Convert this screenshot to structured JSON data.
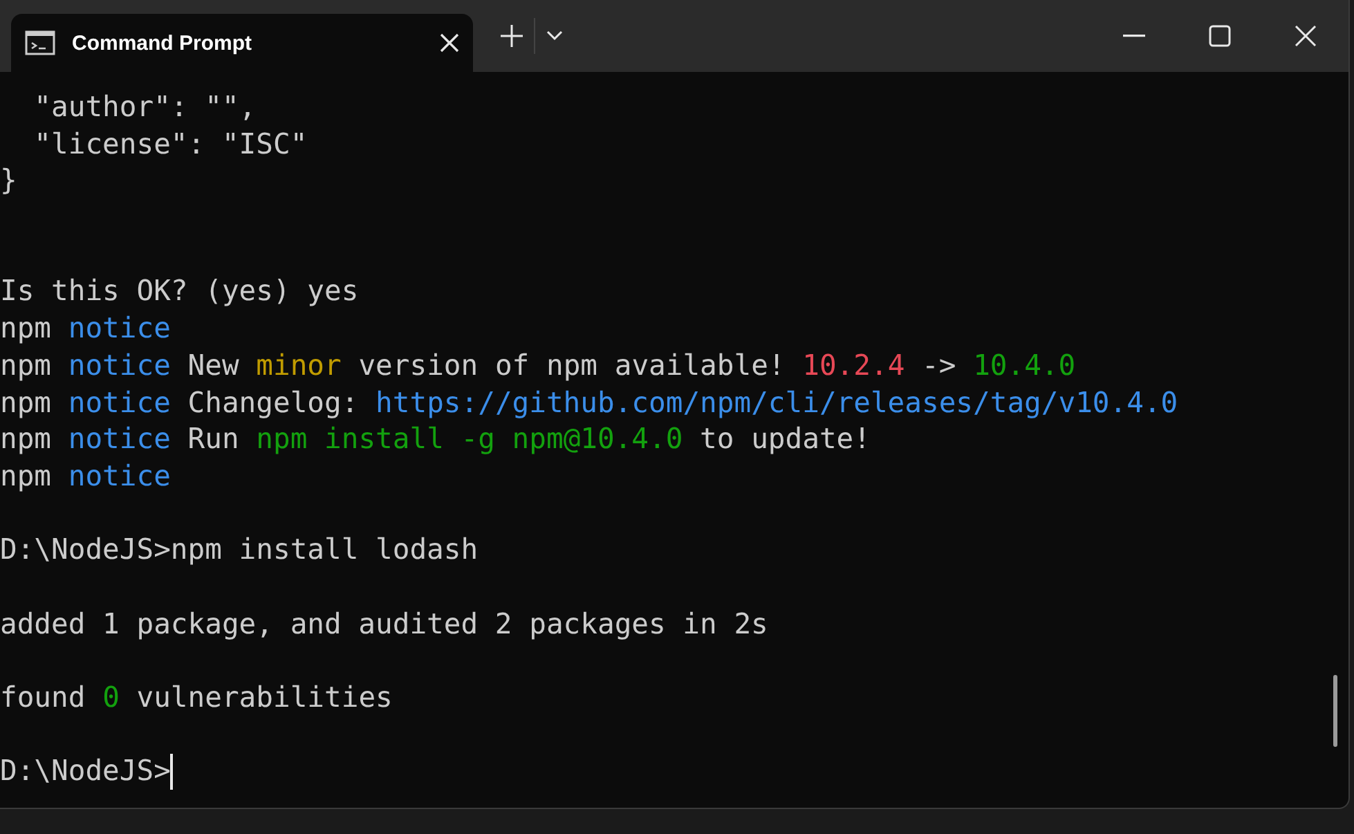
{
  "window": {
    "tabs": [
      {
        "title": "Command Prompt",
        "selected": true
      }
    ]
  },
  "terminal": {
    "cursor_visible": true,
    "lines": [
      {
        "kind": "output",
        "segments": [
          {
            "text": "  \"author\": \"\",",
            "kind": "plain"
          }
        ]
      },
      {
        "kind": "output",
        "segments": [
          {
            "text": "  \"license\": \"ISC\"",
            "kind": "plain"
          }
        ]
      },
      {
        "kind": "output",
        "segments": [
          {
            "text": "}",
            "kind": "plain"
          }
        ]
      },
      {
        "kind": "blank"
      },
      {
        "kind": "blank"
      },
      {
        "kind": "output",
        "segments": [
          {
            "text": "Is this OK? (yes) yes",
            "kind": "plain"
          }
        ]
      },
      {
        "kind": "output",
        "segments": [
          {
            "text": "npm ",
            "kind": "plain"
          },
          {
            "text": "notice",
            "kind": "notice"
          }
        ]
      },
      {
        "kind": "output",
        "segments": [
          {
            "text": "npm ",
            "kind": "plain"
          },
          {
            "text": "notice",
            "kind": "notice"
          },
          {
            "text": " New ",
            "kind": "plain"
          },
          {
            "text": "minor",
            "kind": "warning"
          },
          {
            "text": " version of npm available! ",
            "kind": "plain"
          },
          {
            "text": "10.2.4",
            "kind": "error"
          },
          {
            "text": " -> ",
            "kind": "plain"
          },
          {
            "text": "10.4.0",
            "kind": "success"
          }
        ]
      },
      {
        "kind": "output",
        "segments": [
          {
            "text": "npm ",
            "kind": "plain"
          },
          {
            "text": "notice",
            "kind": "notice"
          },
          {
            "text": " Changelog: ",
            "kind": "plain"
          },
          {
            "text": "https://github.com/npm/cli/releases/tag/v10.4.0",
            "kind": "notice"
          }
        ]
      },
      {
        "kind": "output",
        "segments": [
          {
            "text": "npm ",
            "kind": "plain"
          },
          {
            "text": "notice",
            "kind": "notice"
          },
          {
            "text": " Run ",
            "kind": "plain"
          },
          {
            "text": "npm install -g npm@10.4.0",
            "kind": "success"
          },
          {
            "text": " to update!",
            "kind": "plain"
          }
        ]
      },
      {
        "kind": "output",
        "segments": [
          {
            "text": "npm ",
            "kind": "plain"
          },
          {
            "text": "notice",
            "kind": "notice"
          }
        ]
      },
      {
        "kind": "blank"
      },
      {
        "kind": "output",
        "segments": [
          {
            "text": "D:\\NodeJS>npm install lodash",
            "kind": "plain"
          }
        ]
      },
      {
        "kind": "blank"
      },
      {
        "kind": "output",
        "segments": [
          {
            "text": "added 1 package, and audited 2 packages in 2s",
            "kind": "plain"
          }
        ]
      },
      {
        "kind": "blank"
      },
      {
        "kind": "output",
        "segments": [
          {
            "text": "found ",
            "kind": "plain"
          },
          {
            "text": "0",
            "kind": "success"
          },
          {
            "text": " vulnerabilities",
            "kind": "plain"
          }
        ]
      },
      {
        "kind": "blank"
      },
      {
        "kind": "output",
        "segments": [
          {
            "text": "D:\\NodeJS>",
            "kind": "plain"
          }
        ]
      }
    ]
  }
}
